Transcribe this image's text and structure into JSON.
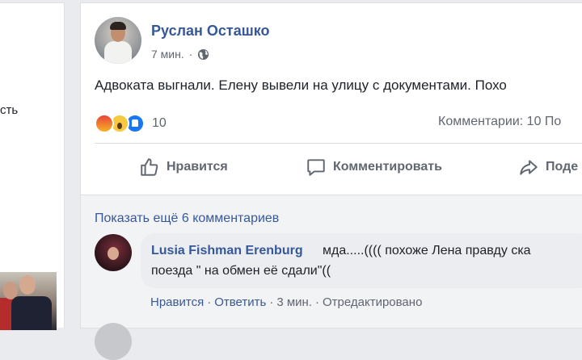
{
  "left_column": {
    "text_fragment": "сть"
  },
  "post": {
    "author": "Руслан Осташко",
    "time": "7 мин.",
    "text": "Адвоката выгнали. Елену вывели на улицу с документами. Похо",
    "reactions_count": "10",
    "comments_count": "Комментарии: 10  По",
    "actions": {
      "like": "Нравится",
      "comment": "Комментировать",
      "share": "Поде"
    }
  },
  "comments": {
    "show_more": "Показать ещё 6 комментариев",
    "first": {
      "author": "Lusia Fishman Erenburg",
      "text_line1": "мда.....(((( похоже Лена правду ска",
      "text_line2": "поезда \" на обмен её сдали\"((",
      "actions": {
        "like": "Нравится",
        "reply": "Ответить",
        "time": "3 мин.",
        "edited": "Отредактировано"
      }
    }
  },
  "icons": [
    "globe-icon",
    "angry-reaction-icon",
    "wow-reaction-icon",
    "like-reaction-icon",
    "thumbs-up-icon",
    "comment-icon",
    "share-icon"
  ],
  "colors": {
    "link": "#365899",
    "muted": "#606770",
    "background": "#e9ebee",
    "like_blue": "#1877f2"
  }
}
